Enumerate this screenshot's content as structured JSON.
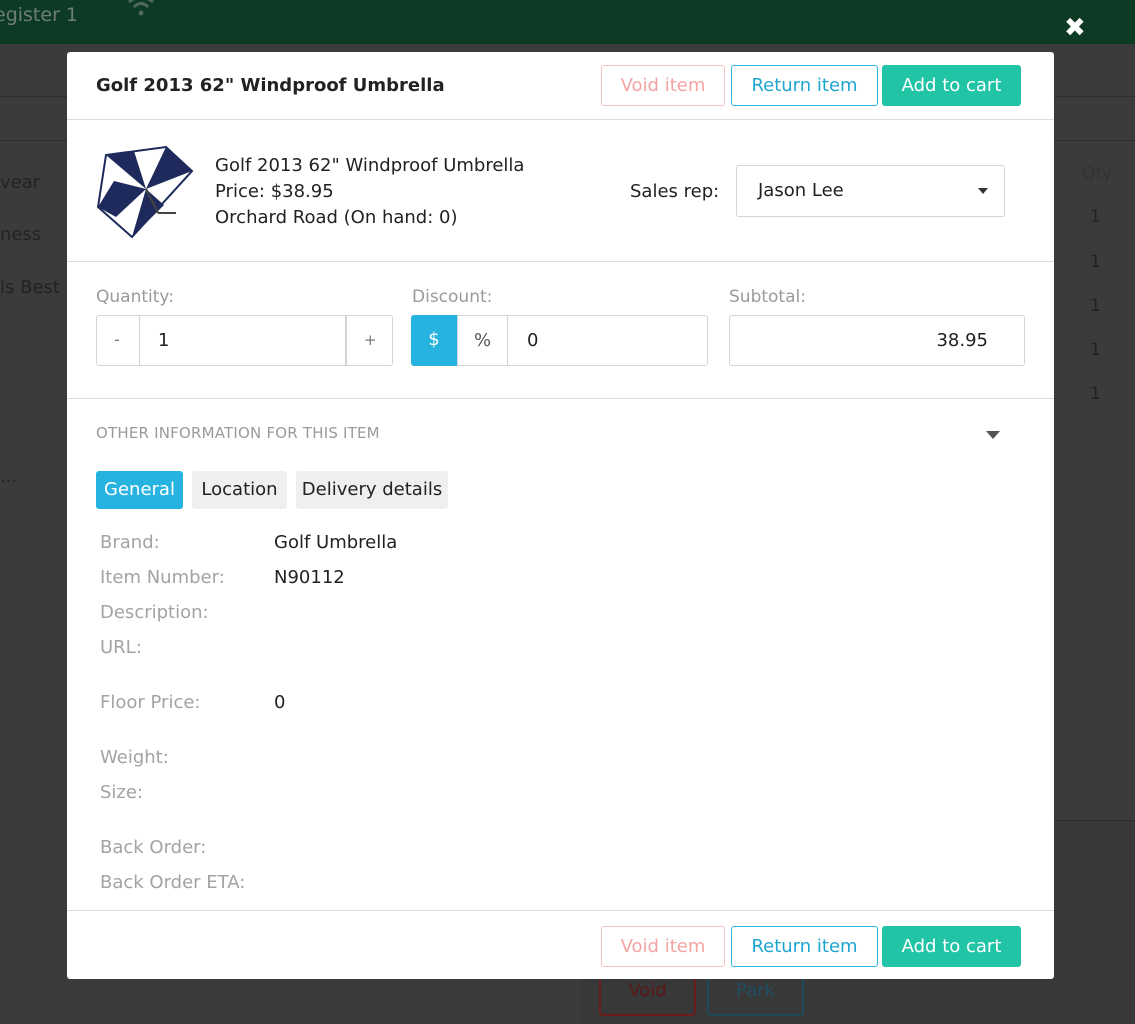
{
  "background": {
    "register_label": "egister 1",
    "side_labels": [
      "vear",
      "ness",
      "ls Best S",
      "..."
    ],
    "qty_header": "Qty",
    "qty_values": [
      "1",
      "1",
      "1",
      "1",
      "1"
    ],
    "void_label": "Void",
    "park_label": "Park"
  },
  "modal": {
    "title": "Golf 2013 62\" Windproof Umbrella",
    "header_actions": {
      "void": "Void item",
      "return": "Return item",
      "add": "Add to cart"
    },
    "product": {
      "name": "Golf 2013 62\" Windproof Umbrella",
      "price": "Price: $38.95",
      "stock": "Orchard Road (On hand: 0)"
    },
    "sales_rep": {
      "label": "Sales rep:",
      "value": "Jason Lee"
    },
    "quantity": {
      "label": "Quantity:",
      "minus": "-",
      "value": "1",
      "plus": "+"
    },
    "discount": {
      "label": "Discount:",
      "dollar": "$",
      "percent": "%",
      "value": "0"
    },
    "subtotal": {
      "label": "Subtotal:",
      "value": "38.95"
    },
    "other_info": {
      "title": "OTHER INFORMATION FOR THIS ITEM",
      "tabs": [
        "General",
        "Location",
        "Delivery details"
      ],
      "fields": {
        "brand_label": "Brand:",
        "brand_value": "Golf Umbrella",
        "item_number_label": "Item Number:",
        "item_number_value": "N90112",
        "description_label": "Description:",
        "url_label": "URL:",
        "floor_price_label": "Floor Price:",
        "floor_price_value": "0",
        "weight_label": "Weight:",
        "size_label": "Size:",
        "back_order_label": "Back Order:",
        "back_order_eta_label": "Back Order ETA:"
      }
    },
    "footer_actions": {
      "void": "Void item",
      "return": "Return item",
      "add": "Add to cart"
    }
  },
  "colors": {
    "accent_blue": "#27b3e0",
    "add_green": "#22c4a6",
    "void_red": "#f4a3a3",
    "overlay": "#3b3b3b"
  }
}
